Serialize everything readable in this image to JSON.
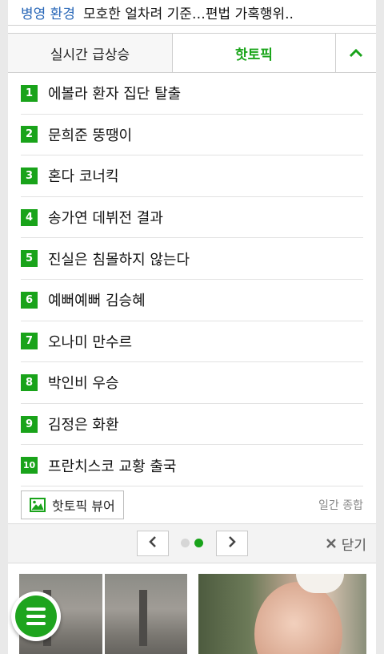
{
  "headline": {
    "category": "병영 환경",
    "text": "모호한 얼차려 기준…편법 가혹행위.."
  },
  "tabs": {
    "realtime": "실시간 급상승",
    "hottopic": "핫토픽"
  },
  "hottopics": [
    {
      "rank": "1",
      "label": "에볼라 환자 집단 탈출"
    },
    {
      "rank": "2",
      "label": "문희준 뚱땡이"
    },
    {
      "rank": "3",
      "label": "혼다 코너킥"
    },
    {
      "rank": "4",
      "label": "송가연 데뷔전 결과"
    },
    {
      "rank": "5",
      "label": "진실은 침몰하지 않는다"
    },
    {
      "rank": "6",
      "label": "예뻐예뻐 김승혜"
    },
    {
      "rank": "7",
      "label": "오나미 만수르"
    },
    {
      "rank": "8",
      "label": "박인비 우승"
    },
    {
      "rank": "9",
      "label": "김정은 화환"
    },
    {
      "rank": "10",
      "label": "프란치스코 교황 출국"
    }
  ],
  "footer": {
    "viewer_label": "핫토픽 뷰어",
    "period_label": "일간 종합"
  },
  "pager": {
    "close_label": "닫기",
    "current_page": 2,
    "total_pages": 2
  },
  "colors": {
    "accent": "#19a31a",
    "headline_category": "#2a68b8"
  }
}
